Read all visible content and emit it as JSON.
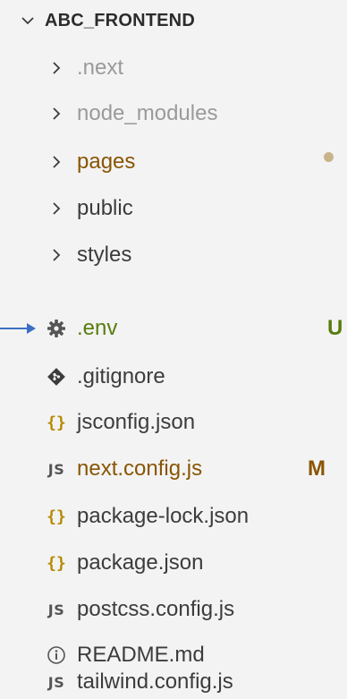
{
  "explorer": {
    "root_label": "ABC_FRONTEND",
    "items": [
      {
        "label": ".next",
        "kind": "folder",
        "icon": "chevron-right-icon",
        "status": "muted"
      },
      {
        "label": "node_modules",
        "kind": "folder",
        "icon": "chevron-right-icon",
        "status": "muted"
      },
      {
        "label": "pages",
        "kind": "folder",
        "icon": "chevron-right-icon",
        "status": "modified",
        "decoration": "dot"
      },
      {
        "label": "public",
        "kind": "folder",
        "icon": "chevron-right-icon",
        "status": "normal"
      },
      {
        "label": "styles",
        "kind": "folder",
        "icon": "chevron-right-icon",
        "status": "normal"
      },
      {
        "label": ".env",
        "kind": "file",
        "icon": "gear-icon",
        "status": "untracked",
        "decoration": "U"
      },
      {
        "label": ".gitignore",
        "kind": "file",
        "icon": "git-diamond-icon",
        "status": "normal"
      },
      {
        "label": "jsconfig.json",
        "kind": "file",
        "icon": "json-braces-icon",
        "status": "normal"
      },
      {
        "label": "next.config.js",
        "kind": "file",
        "icon": "js-file-icon",
        "status": "modified",
        "decoration": "M"
      },
      {
        "label": "package-lock.json",
        "kind": "file",
        "icon": "json-braces-icon",
        "status": "normal"
      },
      {
        "label": "package.json",
        "kind": "file",
        "icon": "json-braces-icon",
        "status": "normal"
      },
      {
        "label": "postcss.config.js",
        "kind": "file",
        "icon": "js-file-icon",
        "status": "normal"
      },
      {
        "label": "README.md",
        "kind": "file",
        "icon": "info-circle-icon",
        "status": "normal"
      },
      {
        "label": "tailwind.config.js",
        "kind": "file",
        "icon": "js-file-icon",
        "status": "normal"
      }
    ]
  },
  "colors": {
    "background": "#f3f3f3",
    "text": "#3c3c3c",
    "muted": "#9a9a9a",
    "modified": "#895503",
    "untracked": "#587c0c",
    "arrow": "#3b6fc4",
    "dot": "#c9b48a"
  }
}
